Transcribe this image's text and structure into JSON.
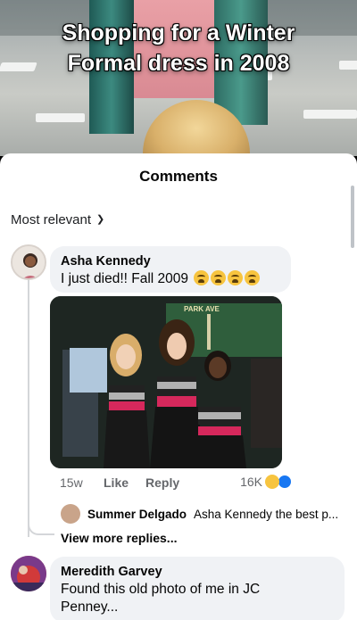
{
  "video": {
    "caption_line1": "Shopping for a Winter",
    "caption_line2": "Formal dress in 2008"
  },
  "sheet": {
    "title": "Comments",
    "sort_label": "Most relevant"
  },
  "comments": [
    {
      "author": "Asha Kennedy",
      "text": "I just died!! Fall 2009",
      "emoji_count": 4,
      "photo_sign": "PARK AVE",
      "time": "15w",
      "like_label": "Like",
      "reply_label": "Reply",
      "reaction_count": "16K"
    },
    {
      "author": "Meredith Garvey",
      "text_line1": "Found this old photo of me in JC",
      "text_line2": "Penney..."
    }
  ],
  "reply": {
    "author": "Summer Delgado",
    "text": "Asha Kennedy the best p..."
  },
  "view_more": "View more replies...",
  "colors": {
    "sheet_bg": "#ffffff",
    "bubble_bg": "#f0f2f5",
    "meta_gray": "#65676b",
    "haha_yellow": "#f7c43f",
    "like_blue": "#1877f2"
  }
}
